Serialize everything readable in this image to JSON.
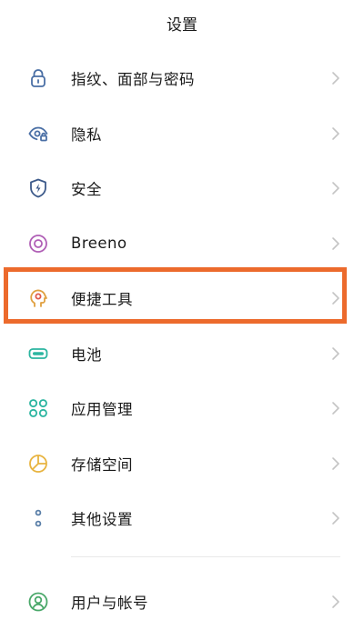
{
  "header": {
    "title": "设置"
  },
  "settings": {
    "items": [
      {
        "label": "指纹、面部与密码",
        "icon": "lock-icon",
        "color": "#4a6fa5"
      },
      {
        "label": "隐私",
        "icon": "eye-lock-icon",
        "color": "#4a6fa5"
      },
      {
        "label": "安全",
        "icon": "shield-bolt-icon",
        "color": "#3d5a8a"
      },
      {
        "label": "Breeno",
        "icon": "breeno-ring-icon",
        "color": "#b05fb6"
      },
      {
        "label": "便捷工具",
        "icon": "head-tool-icon",
        "color": "#e0a040"
      },
      {
        "label": "电池",
        "icon": "battery-icon",
        "color": "#2bb5a0"
      },
      {
        "label": "应用管理",
        "icon": "app-grid-icon",
        "color": "#2bb5a0"
      },
      {
        "label": "存储空间",
        "icon": "pie-storage-icon",
        "color": "#e8b440"
      },
      {
        "label": "其他设置",
        "icon": "dots-more-icon",
        "color": "#5a7fa8"
      },
      {
        "label": "用户与帐号",
        "icon": "user-account-icon",
        "color": "#4aa86a"
      }
    ]
  },
  "colors": {
    "highlight": "#ec6a2c",
    "chevron": "#c4c4c4"
  }
}
